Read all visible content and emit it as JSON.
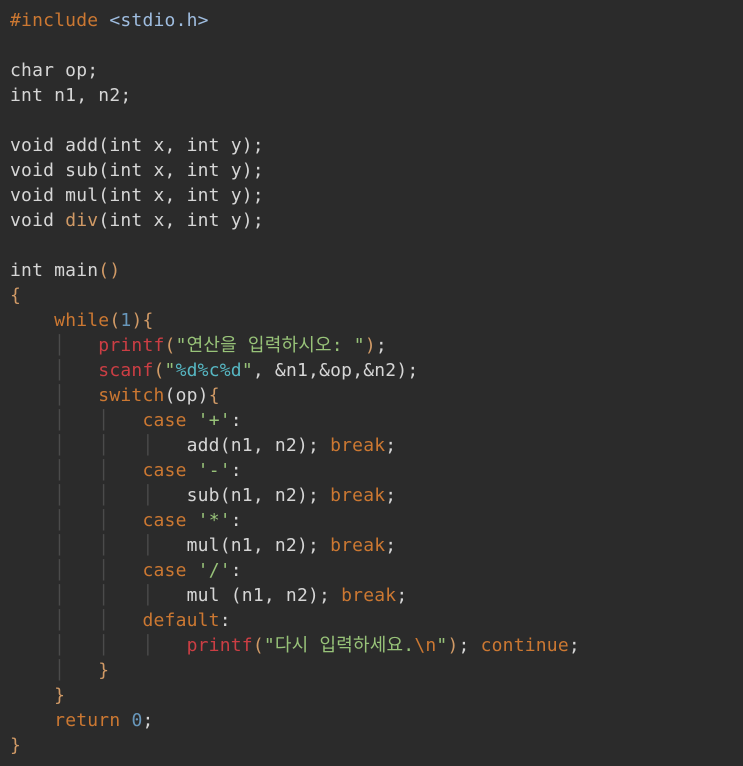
{
  "code": {
    "include_directive": "#include",
    "include_header": "<stdio.h>",
    "decl_char_op": "char op;",
    "decl_int_n1n2": "int n1, n2;",
    "proto_add": "void add(int x, int y);",
    "proto_sub": "void sub(int x, int y);",
    "proto_mul": "void mul(int x, int y);",
    "proto_div_pre": "void ",
    "proto_div_name": "div",
    "proto_div_post": "(int x, int y);",
    "main_sig": "int main",
    "brace_open": "{",
    "brace_close": "}",
    "while_kw": "while",
    "while_cond_open": "(",
    "while_cond_num": "1",
    "while_cond_close": ")",
    "printf": "printf",
    "scanf": "scanf",
    "switch": "switch",
    "switch_arg": "(op)",
    "case": "case",
    "default": "default",
    "break": "break",
    "continue": "continue",
    "return": "return",
    "return_val": "0",
    "semicolon": ";",
    "colon": ":",
    "str_prompt": "\"연산을 입력하시오: \"",
    "str_fmt_open": "\"",
    "str_fmt_d1": "%d",
    "str_fmt_c": "%c",
    "str_fmt_d2": "%d",
    "str_fmt_close": "\"",
    "scanf_args": ", &n1,&op,&n2)",
    "char_plus": "'+'",
    "char_minus": "'-'",
    "char_star": "'*'",
    "char_slash": "'/'",
    "call_add": "add(n1, n2); ",
    "call_sub": "sub(n1, n2); ",
    "call_mul": "mul(n1, n2); ",
    "call_mul2": "mul (n1, n2); ",
    "str_retry_open": "\"다시 입력하세요.",
    "str_retry_nl": "\\n",
    "str_retry_close": "\"",
    "paren_open": "(",
    "paren_close": ")",
    "empty_paren": "()"
  }
}
